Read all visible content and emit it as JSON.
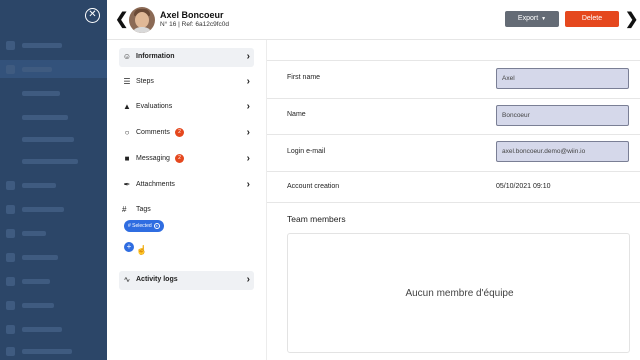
{
  "header": {
    "name": "Axel Boncoeur",
    "ref": "N° 16 | Ref: 6a12c9fc0d",
    "export_label": "Export",
    "delete_label": "Delete"
  },
  "menu": {
    "items": [
      {
        "label": "Information",
        "icon": "user-icon",
        "active": true
      },
      {
        "label": "Steps",
        "icon": "layers-icon"
      },
      {
        "label": "Evaluations",
        "icon": "shapes-icon"
      },
      {
        "label": "Comments",
        "icon": "chat-bubbles-icon",
        "badge": "2"
      },
      {
        "label": "Messaging",
        "icon": "message-icon",
        "badge": "2"
      },
      {
        "label": "Attachments",
        "icon": "paperclip-icon"
      },
      {
        "label": "Activity logs",
        "icon": "activity-icon"
      }
    ],
    "tags_label": "Tags",
    "tag_chip": "# Selected"
  },
  "form": {
    "first_name_label": "First name",
    "first_name_value": "Axel",
    "name_label": "Name",
    "name_value": "Boncoeur",
    "email_label": "Login e-mail",
    "email_value": "axel.boncoeur.demo@wiin.io",
    "creation_label": "Account creation",
    "creation_value": "05/10/2021 09:10"
  },
  "team": {
    "title": "Team members",
    "empty_text": "Aucun membre d'équipe"
  },
  "colors": {
    "accent_blue": "#2f6de1",
    "delete_red": "#e5481e",
    "export_grey": "#646b75",
    "input_fill": "#d5d8ea"
  }
}
